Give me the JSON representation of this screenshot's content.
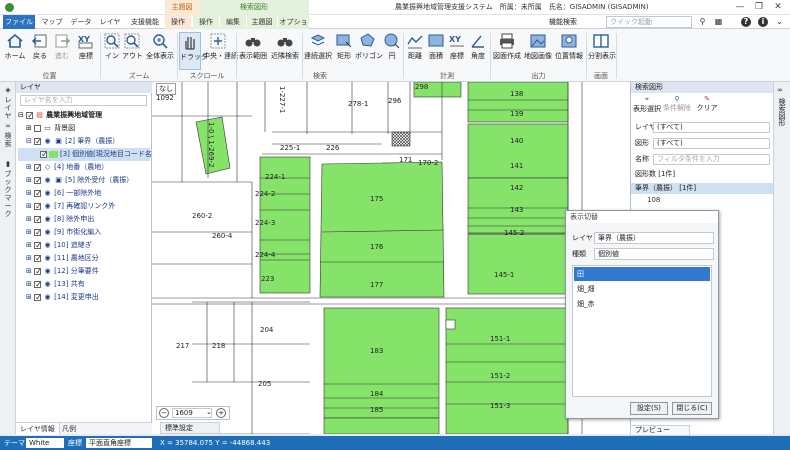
{
  "title_bar": {
    "context_group_main": "主題図",
    "context_group_search": "検索図形",
    "window_title": "農業振興地域管理支援システム　所属：未所属　氏名：GISADMIN (GISADMIN)",
    "minimize": "—",
    "restore": "❐",
    "close": "✕"
  },
  "tabs": [
    "ファイル",
    "マップ",
    "データ",
    "レイヤ",
    "支援機能",
    "操作",
    "操作",
    "編集",
    "主題図",
    "オプション"
  ],
  "function_search": {
    "label": "機能検索",
    "placeholder": "クイック起動"
  },
  "ribbon": {
    "buttons": [
      "ホーム",
      "戻る",
      "進む",
      "座標",
      "イン",
      "アウト",
      "全体表示",
      "ドラッグ",
      "中央・連続",
      "表示範囲",
      "近隣検索",
      "連続選択",
      "矩形",
      "ポリゴン",
      "円",
      "距離",
      "面積",
      "座標",
      "角度",
      "図面作成",
      "地図画像",
      "位置情報",
      "分割表示"
    ],
    "groups": [
      "位置",
      "ズーム",
      "スクロール",
      "検索",
      "計測",
      "出力",
      "画面"
    ]
  },
  "left_strip": [
    "レイヤ",
    "検索",
    "ブックマーク"
  ],
  "layer_panel": {
    "title": "レイヤ",
    "search_placeholder": "レイヤ名を入力",
    "root": "農業振興地域管理",
    "items": [
      "背景図",
      "[2] 筆界（農振）",
      "[3] 個別値[現況地目コード名称]",
      "[4] 地番（農地）",
      "[5] 除外受付（農振）",
      "[6] 一部除外地",
      "[7] 再確認リンク外",
      "[8] 除外申出",
      "[9] 市街化編入",
      "[10] 追継ぎ",
      "[11] 農地区分",
      "[12] 分筆要件",
      "[13] 共有",
      "[14] 変更申出"
    ],
    "bottom_tabs": [
      "レイヤ情報",
      "凡例"
    ]
  },
  "map": {
    "parcels": [
      "298",
      "138",
      "139",
      "140",
      "141",
      "142",
      "143",
      "145-2",
      "145-1",
      "151-1",
      "151-2",
      "151-3",
      "175",
      "176",
      "177",
      "183",
      "184",
      "185",
      "224-1",
      "224-2",
      "224-3",
      "224-4",
      "223",
      "225-1",
      "226",
      "171",
      "170-2",
      "278-1",
      "296",
      "260-2",
      "260-4",
      "204",
      "205",
      "217",
      "218",
      "1092",
      "なし"
    ],
    "road_label": "1-0 \\ 1-269-2",
    "road_label2": "1-227-1",
    "scale": "1609",
    "settings_tab": "標準設定"
  },
  "search_panel": {
    "title": "検索図形",
    "tools": [
      "表形選択",
      "条件解除",
      "クリア"
    ],
    "layer_label": "レイヤ",
    "layer_value": "(すべて)",
    "shape_label": "図形",
    "shape_value": "(すべて)",
    "name_label": "名称",
    "name_placeholder": "フィルタ条件を入力",
    "count_label": "図形数 [1件]",
    "tree_group": "筆界（農振） [1件]",
    "tree_item": "108",
    "preview_tab": "プレビュー"
  },
  "right_strip": [
    "検索図形"
  ],
  "dialog": {
    "title": "表示切替",
    "layer_label": "レイヤ",
    "layer_value": "筆界（農振）",
    "kind_label": "種類",
    "kind_value": "個別値",
    "list": [
      "田",
      "畑_畑",
      "畑_赤"
    ],
    "ok": "設定(S)",
    "close": "閉じる(C)"
  },
  "status_bar": {
    "theme_label": "テーマ",
    "theme_value": "White",
    "coord_label": "座標",
    "coord_value": "平面直角座標",
    "position": "X = 35784.075  Y = -44868.443"
  },
  "colors": {
    "accent": "#2b74c2",
    "parcel_green": "#86e36a",
    "selection": "#2f7ad0"
  }
}
